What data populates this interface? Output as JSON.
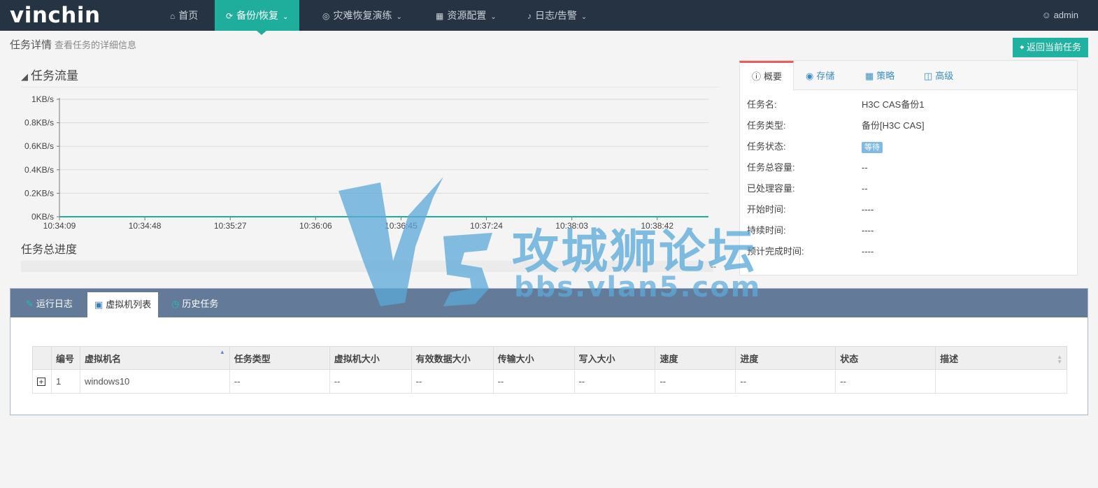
{
  "nav": {
    "logo": "vinchin",
    "items": [
      {
        "label": "首页",
        "icon": "home-icon"
      },
      {
        "label": "备份/恢复",
        "icon": "refresh-icon",
        "active": true
      },
      {
        "label": "灾难恢复演练",
        "icon": "drill-icon"
      },
      {
        "label": "资源配置",
        "icon": "grid-icon"
      },
      {
        "label": "日志/告警",
        "icon": "bell-icon"
      }
    ],
    "user": "admin"
  },
  "page": {
    "title": "任务详情",
    "subtitle": "查看任务的详细信息",
    "back_button": "返回当前任务"
  },
  "flow": {
    "title": "任务流量"
  },
  "chart_data": {
    "type": "line",
    "title": "任务流量",
    "x": [
      "10:34:09",
      "10:34:48",
      "10:35:27",
      "10:36:06",
      "10:36:45",
      "10:37:24",
      "10:38:03",
      "10:38:42"
    ],
    "y_ticks": [
      "0KB/s",
      "0.2KB/s",
      "0.4KB/s",
      "0.6KB/s",
      "0.8KB/s",
      "1KB/s"
    ],
    "ylim": [
      0,
      1
    ],
    "yunit": "KB/s",
    "series": [
      {
        "values": [
          0,
          0,
          0,
          0,
          0,
          0,
          0,
          0
        ],
        "color": "#1fae9c"
      }
    ],
    "grid": true
  },
  "progress": {
    "title": "任务总进度",
    "value": "--"
  },
  "summary": {
    "tabs": [
      {
        "label": "概要",
        "icon": "info-icon",
        "active": true
      },
      {
        "label": "存储",
        "icon": "storage-icon"
      },
      {
        "label": "策略",
        "icon": "calendar-icon"
      },
      {
        "label": "高级",
        "icon": "advanced-icon"
      }
    ],
    "rows": [
      {
        "label": "任务名:",
        "value": "H3C CAS备份1"
      },
      {
        "label": "任务类型:",
        "value": "备份[H3C CAS]"
      },
      {
        "label": "任务状态:",
        "value": "等待"
      },
      {
        "label": "任务总容量:",
        "value": "--"
      },
      {
        "label": "已处理容量:",
        "value": "--"
      },
      {
        "label": "开始时间:",
        "value": "----"
      },
      {
        "label": "持续时间:",
        "value": "----"
      },
      {
        "label": "预计完成时间:",
        "value": "----"
      }
    ]
  },
  "bottom_tabs": [
    {
      "label": "运行日志",
      "icon": "edit-icon"
    },
    {
      "label": "虚拟机列表",
      "icon": "monitor-icon",
      "active": true
    },
    {
      "label": "历史任务",
      "icon": "history-icon"
    }
  ],
  "vm_table": {
    "headers": [
      "编号",
      "虚拟机名",
      "任务类型",
      "虚拟机大小",
      "有效数据大小",
      "传输大小",
      "写入大小",
      "速度",
      "进度",
      "状态",
      "描述"
    ],
    "rows": [
      [
        "1",
        "windows10",
        "--",
        "--",
        "--",
        "--",
        "--",
        "--",
        "--",
        "--",
        ""
      ]
    ]
  },
  "watermark": {
    "text": "攻城狮论坛",
    "url": "bbs.vlan5.com"
  }
}
